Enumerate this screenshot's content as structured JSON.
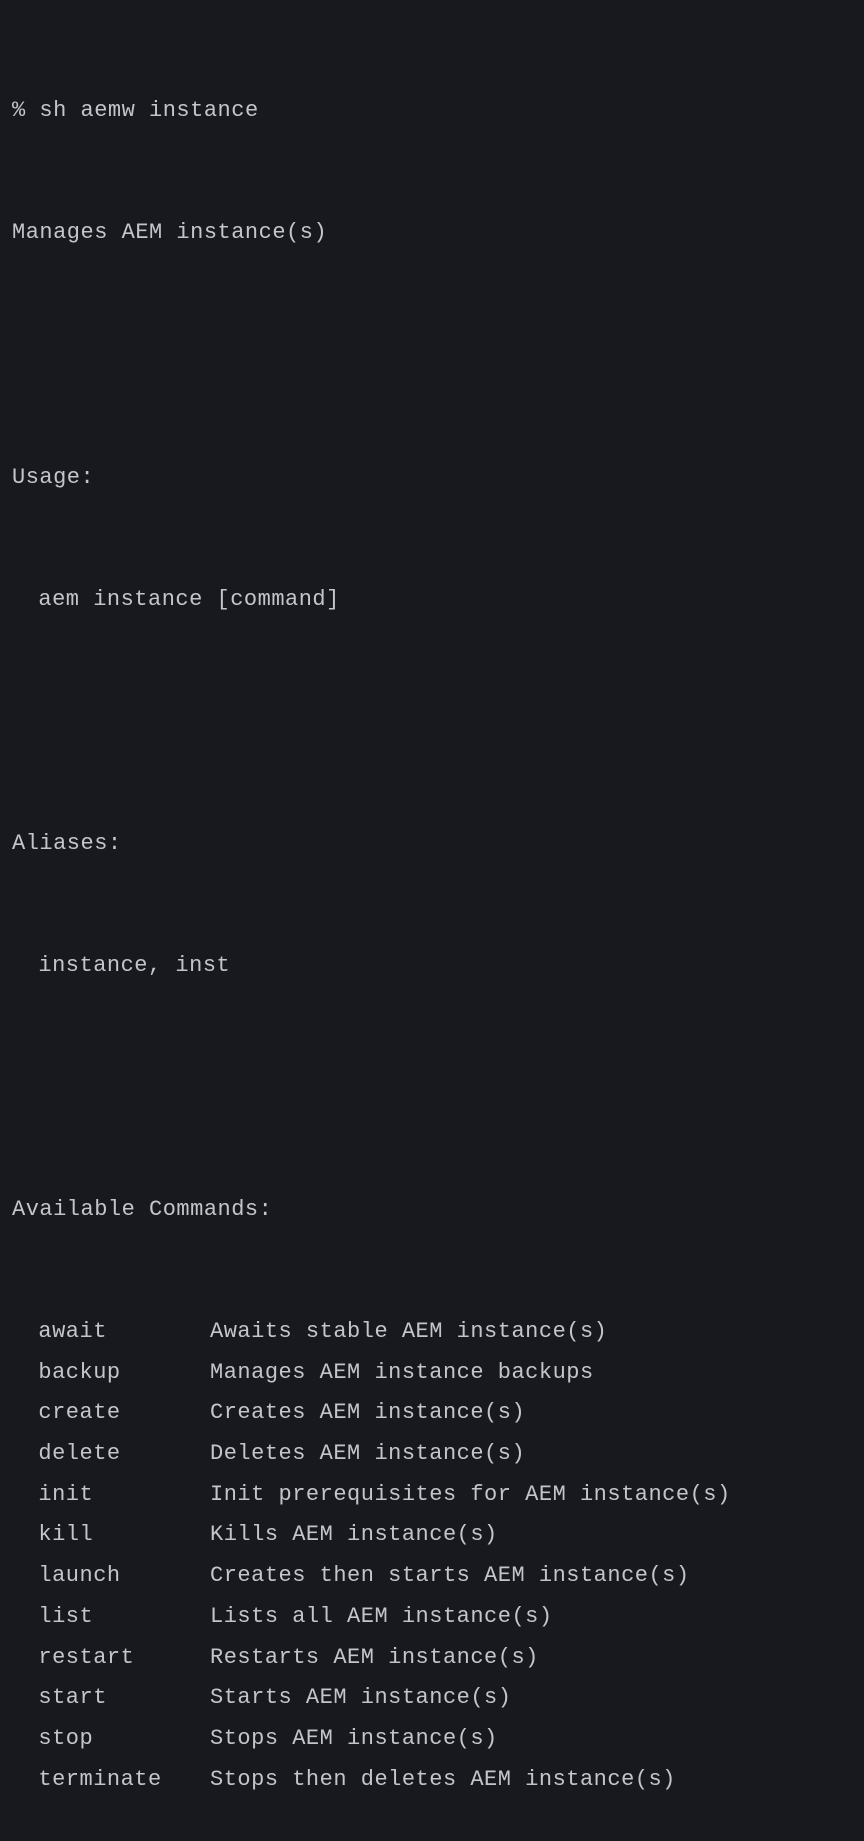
{
  "prompt": "% ",
  "command": "sh aemw instance",
  "description": "Manages AEM instance(s)",
  "usage": {
    "header": "Usage:",
    "line": "aem instance [command]"
  },
  "aliases": {
    "header": "Aliases:",
    "line": "instance, inst"
  },
  "available": {
    "header": "Available Commands:",
    "commands": [
      {
        "name": "await",
        "desc": "Awaits stable AEM instance(s)"
      },
      {
        "name": "backup",
        "desc": "Manages AEM instance backups"
      },
      {
        "name": "create",
        "desc": "Creates AEM instance(s)"
      },
      {
        "name": "delete",
        "desc": "Deletes AEM instance(s)"
      },
      {
        "name": "init",
        "desc": "Init prerequisites for AEM instance(s)"
      },
      {
        "name": "kill",
        "desc": "Kills AEM instance(s)"
      },
      {
        "name": "launch",
        "desc": "Creates then starts AEM instance(s)"
      },
      {
        "name": "list",
        "desc": "Lists all AEM instance(s)"
      },
      {
        "name": "restart",
        "desc": "Restarts AEM instance(s)"
      },
      {
        "name": "start",
        "desc": "Starts AEM instance(s)"
      },
      {
        "name": "stop",
        "desc": "Stops AEM instance(s)"
      },
      {
        "name": "terminate",
        "desc": "Stops then deletes AEM instance(s)"
      }
    ]
  }
}
